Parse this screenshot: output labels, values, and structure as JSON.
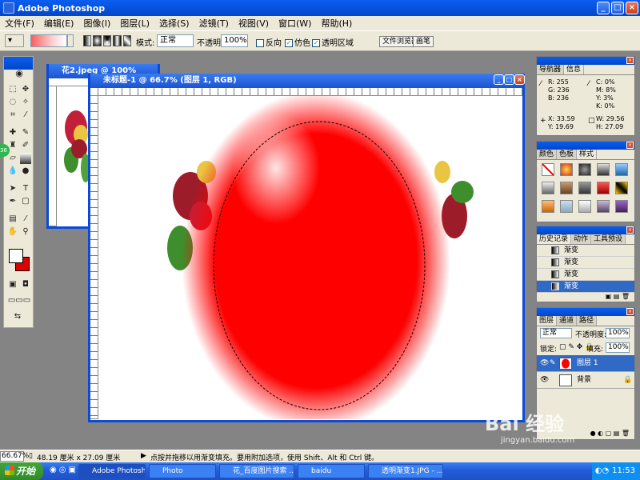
{
  "app": {
    "title": "Adobe Photoshop"
  },
  "menu": [
    "文件(F)",
    "编辑(E)",
    "图像(I)",
    "图层(L)",
    "选择(S)",
    "滤镜(T)",
    "视图(V)",
    "窗口(W)",
    "帮助(H)"
  ],
  "options": {
    "mode_label": "模式:",
    "mode_value": "正常",
    "opacity_label": "不透明度:",
    "opacity_value": "100%",
    "reverse_label": "反向",
    "dither_label": "仿色",
    "transparency_label": "透明区域",
    "file_browser_tab": "文件浏览器",
    "brushes_tab": "画笔"
  },
  "doc_small": {
    "title": "花2.jpeg @ 100%"
  },
  "doc_main": {
    "title": "未标题-1 @ 66.7% (图层 1, RGB)"
  },
  "info": {
    "tabs": [
      "导航器",
      "信息"
    ],
    "R": "255",
    "G": "236",
    "B": "236",
    "C": "0%",
    "M": "8%",
    "Y": "3%",
    "K": "0%",
    "X": "33.59",
    "Y2": "19.69",
    "W": "29.56",
    "H": "27.09"
  },
  "color_panel": {
    "tabs": [
      "颜色",
      "色板",
      "样式"
    ]
  },
  "history": {
    "tabs": [
      "历史记录",
      "动作",
      "工具预设"
    ],
    "items": [
      "渐变",
      "渐变",
      "渐变",
      "渐变"
    ]
  },
  "layers": {
    "tabs": [
      "图层",
      "通道",
      "路径"
    ],
    "blend": "正常",
    "opacity_label": "不透明度:",
    "opacity_value": "100%",
    "lock_label": "锁定:",
    "fill_label": "填充:",
    "fill_value": "100%",
    "rows": [
      {
        "name": "图层 1"
      },
      {
        "name": "背景"
      }
    ]
  },
  "status": {
    "zoom": "66.67%",
    "doc_size": "48.19 厘米 x 27.09 厘米",
    "hint": "点按并拖移以用渐变填充。要用附加选项，使用 Shift、Alt 和 Ctrl 键。"
  },
  "badge": "36",
  "watermark": {
    "text": "Bai 经验",
    "url": "jingyan.baidu.com"
  },
  "taskbar": {
    "start": "开始",
    "tasks": [
      "Adobe Photoshop",
      "Photo",
      "花_百度图片搜索 ...",
      "baidu",
      "透明渐变1.JPG - ..."
    ],
    "clock": "11:53"
  },
  "colors": {
    "accent": "#0a5ef0",
    "selection": "#316ac5",
    "red": "#ff0000"
  }
}
